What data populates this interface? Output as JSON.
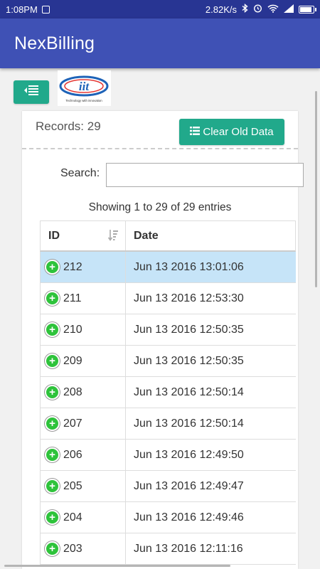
{
  "status_bar": {
    "time": "1:08PM",
    "speed": "2.82K/s"
  },
  "app": {
    "title": "NexBilling"
  },
  "logo": {
    "text": "iit",
    "tagline": "Technology with innovation"
  },
  "records_label": "Records: 29",
  "clear_button": "Clear Old Data",
  "search": {
    "label": "Search:",
    "value": ""
  },
  "info": "Showing 1 to 29 of 29 entries",
  "table": {
    "headers": [
      "ID",
      "Date"
    ],
    "rows": [
      {
        "id": "212",
        "date": "Jun 13 2016 13:01:06"
      },
      {
        "id": "211",
        "date": "Jun 13 2016 12:53:30"
      },
      {
        "id": "210",
        "date": "Jun 13 2016 12:50:35"
      },
      {
        "id": "209",
        "date": "Jun 13 2016 12:50:35"
      },
      {
        "id": "208",
        "date": "Jun 13 2016 12:50:14"
      },
      {
        "id": "207",
        "date": "Jun 13 2016 12:50:14"
      },
      {
        "id": "206",
        "date": "Jun 13 2016 12:49:50"
      },
      {
        "id": "205",
        "date": "Jun 13 2016 12:49:47"
      },
      {
        "id": "204",
        "date": "Jun 13 2016 12:49:46"
      },
      {
        "id": "203",
        "date": "Jun 13 2016 12:11:16"
      }
    ]
  },
  "colors": {
    "primary": "#3f51b5",
    "status_bar": "#283593",
    "accent": "#21a98b",
    "selected_row": "#c6e4f8",
    "expand_button": "#2ec33b"
  }
}
